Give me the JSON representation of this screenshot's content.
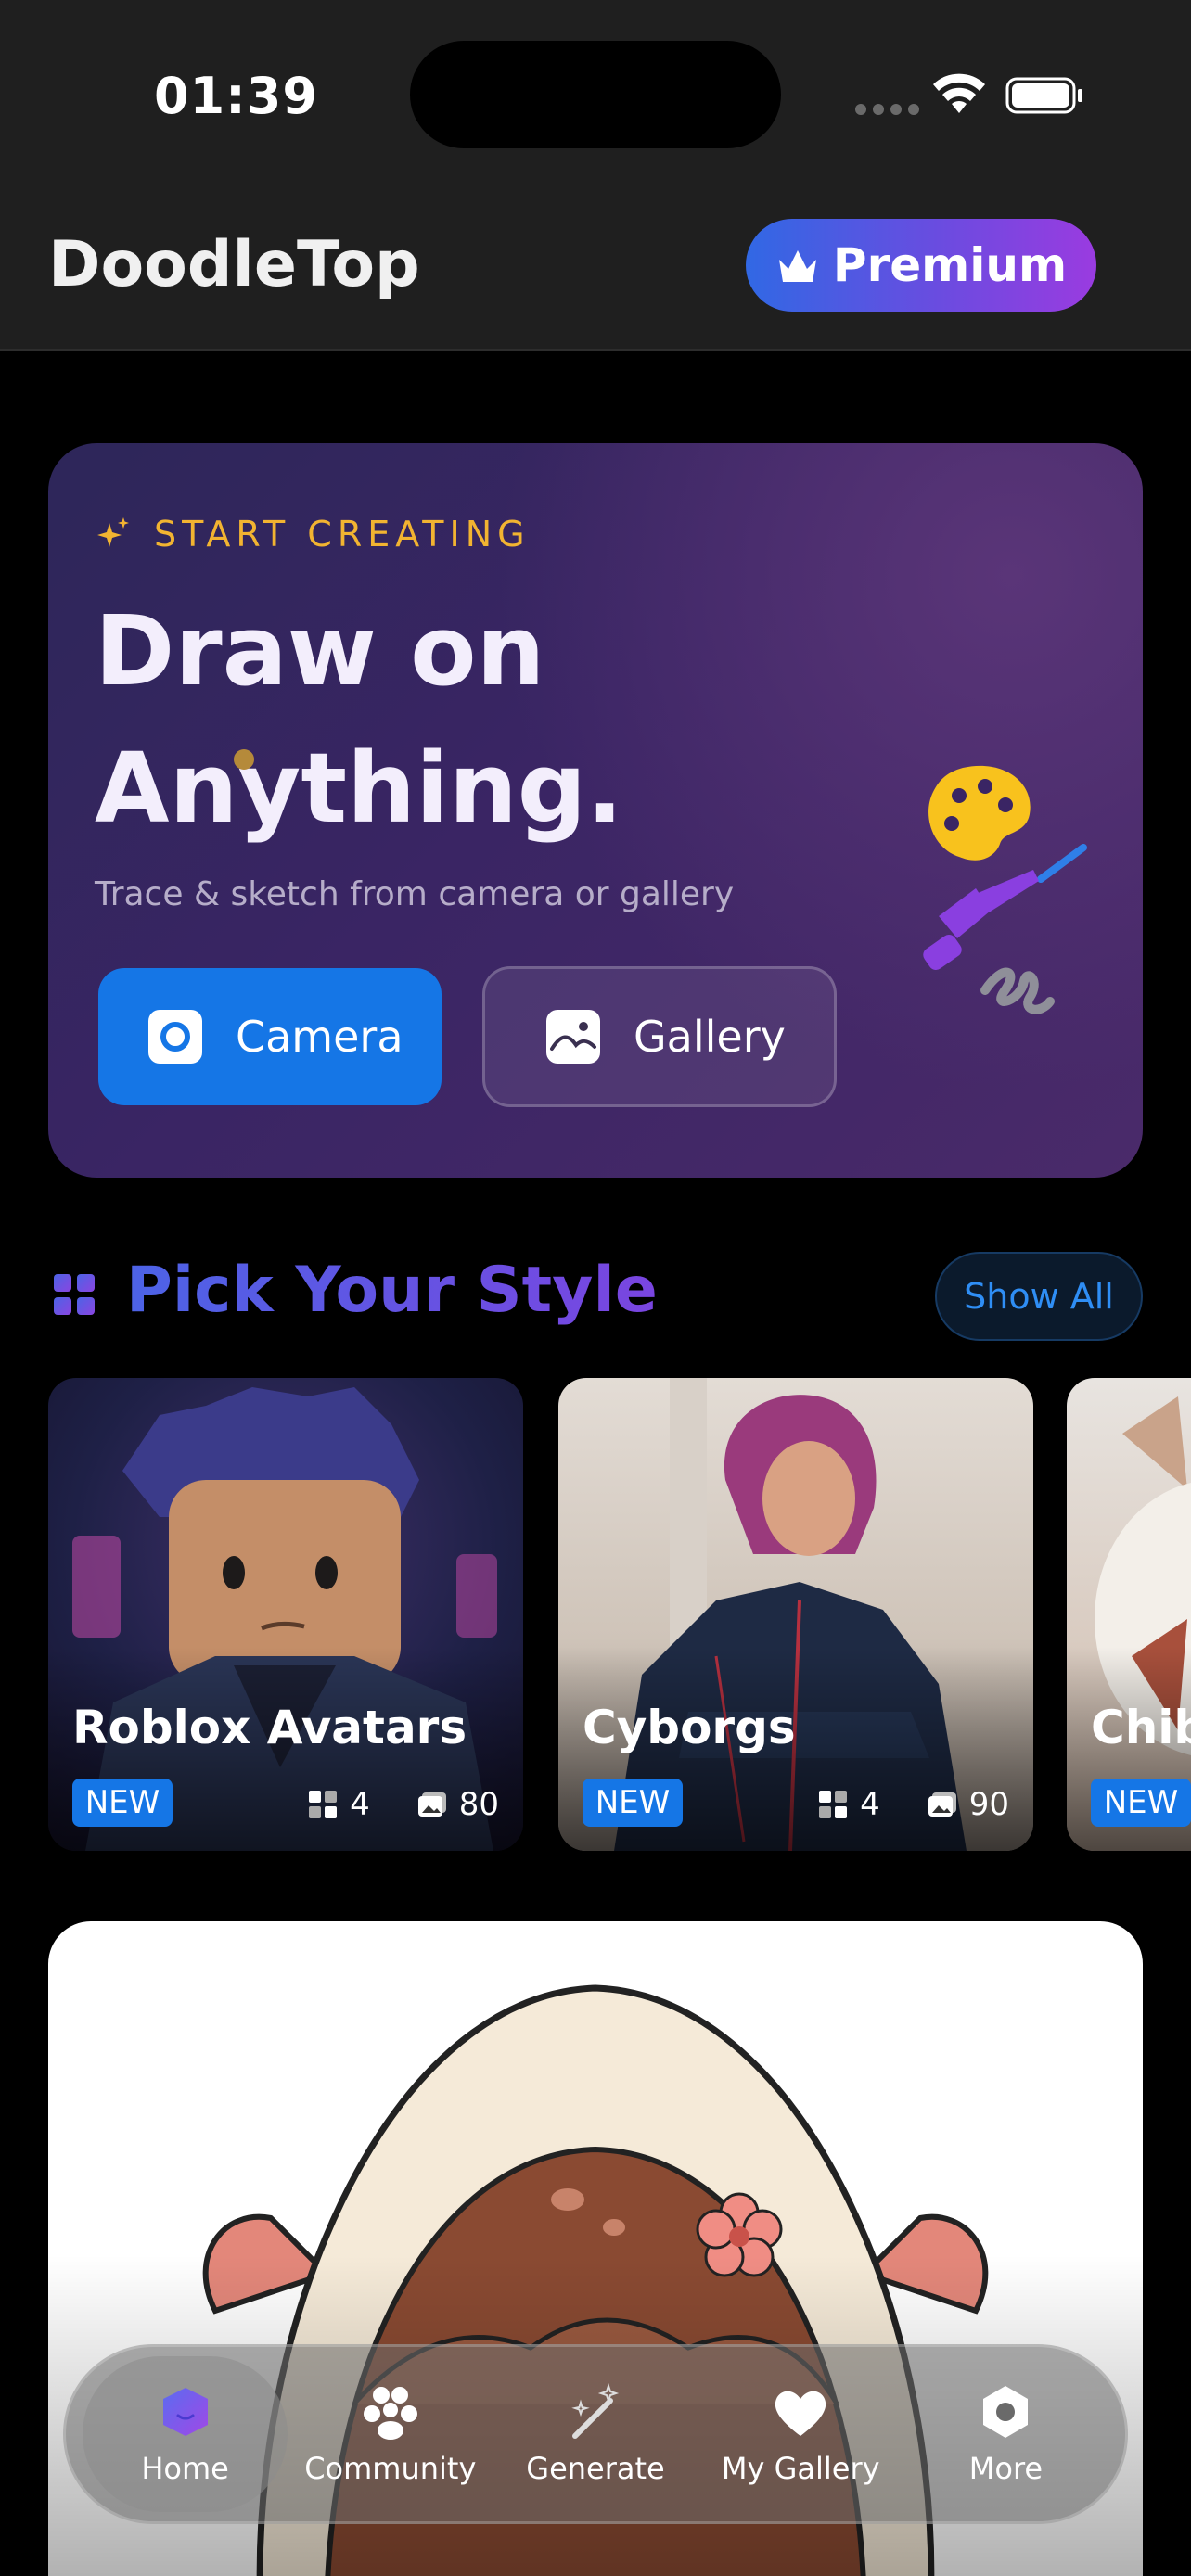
{
  "status_bar": {
    "time": "01:39"
  },
  "header": {
    "app_title": "DoodleTop",
    "premium_label": "Premium"
  },
  "hero": {
    "eyebrow": "START CREATING",
    "title_line1": "Draw on",
    "title_line2": "Anything.",
    "subtitle": "Trace & sketch from camera or gallery",
    "camera_label": "Camera",
    "gallery_label": "Gallery"
  },
  "styles_section": {
    "title": "Pick Your Style",
    "show_all_label": "Show All",
    "cards": [
      {
        "title": "Roblox Avatars",
        "badge": "NEW",
        "sets": "4",
        "images": "80"
      },
      {
        "title": "Cyborgs",
        "badge": "NEW",
        "sets": "4",
        "images": "90"
      },
      {
        "title": "Chib",
        "badge": "NEW"
      }
    ]
  },
  "tab_bar": {
    "tabs": [
      {
        "label": "Home",
        "icon": "home-icon",
        "active": true
      },
      {
        "label": "Community",
        "icon": "community-icon"
      },
      {
        "label": "Generate",
        "icon": "magic-wand-icon"
      },
      {
        "label": "My Gallery",
        "icon": "heart-icon"
      },
      {
        "label": "More",
        "icon": "hexagon-icon"
      }
    ]
  },
  "colors": {
    "accent_blue": "#1576e6",
    "eyebrow_gold": "#f2b431",
    "premium_gradient_start": "#3168e4",
    "premium_gradient_end": "#9a3be0"
  }
}
